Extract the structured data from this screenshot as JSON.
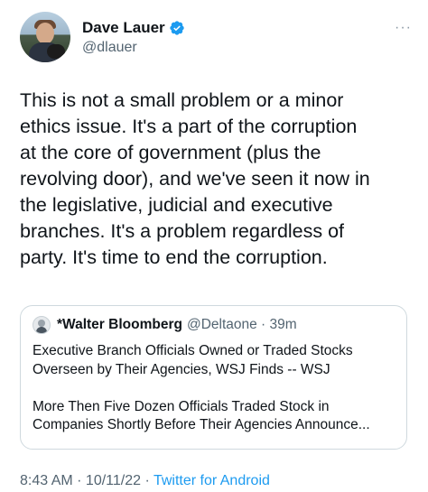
{
  "author": {
    "display_name": "Dave Lauer",
    "handle": "@dlauer",
    "verified": true
  },
  "more_icon": "ellipsis-icon",
  "tweet": {
    "text": "This is not a small problem or a minor\nethics issue. It's a part of the corruption\nat the core of government (plus the\nrevolving door), and we've seen it now in\nthe legislative, judicial and executive\nbranches. It's a problem regardless of\nparty. It's time to end the corruption."
  },
  "quoted_tweet": {
    "display_name": "*Walter Bloomberg",
    "handle_time": "@Deltaone · 39m",
    "text": "Executive Branch Officials Owned or Traded Stocks\nOverseen by Their Agencies, WSJ Finds -- WSJ\n\nMore Then Five Dozen Officials Traded Stock in\nCompanies Shortly Before Their Agencies Announce..."
  },
  "meta": {
    "time": "8:43 AM",
    "separator1": " · ",
    "date": "10/11/22",
    "separator2": " · ",
    "source": "Twitter for Android"
  },
  "colors": {
    "text": "#0f1419",
    "secondary": "#536471",
    "link": "#1d9bf0",
    "border": "#cfd9de"
  }
}
